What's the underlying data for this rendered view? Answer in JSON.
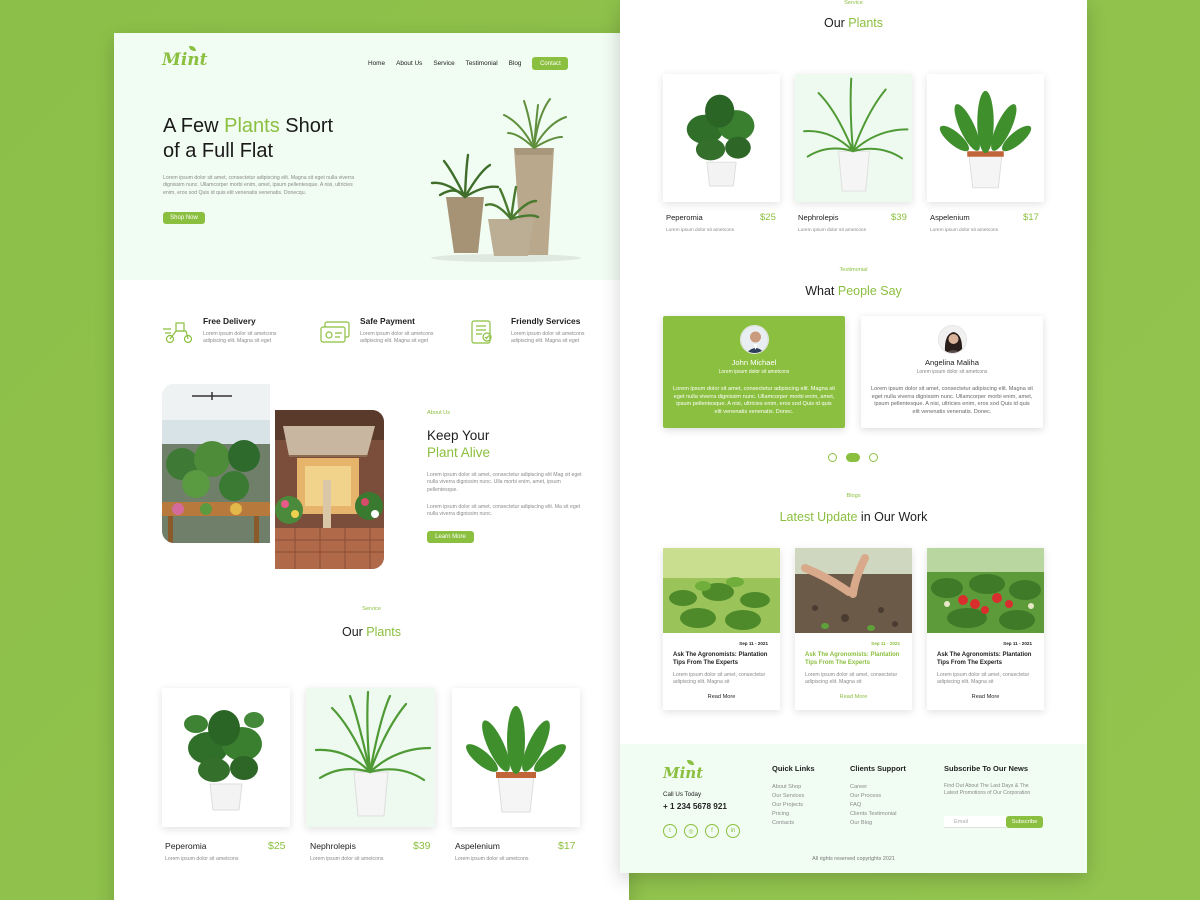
{
  "colors": {
    "accent": "#8bbf3f",
    "hero_bg": "#f1fcf3",
    "background": "#8fc04a"
  },
  "brand": {
    "logo_text": "Mint"
  },
  "nav": {
    "items": [
      "Home",
      "About Us",
      "Service",
      "Testimonial",
      "Blog"
    ],
    "contact": "Contact"
  },
  "hero": {
    "title_pre": "A Few ",
    "title_accent": "Plants",
    "title_post": " Short",
    "title_line2": "of a Full Flat",
    "desc": "Lorem ipsum dolor sit amet, consectetur adipiscing elit. Magna sit eget nulla viverra dignissim nunc. Ullamcorper morbi enim, amet, ipsum pellentesque. A nisi, ultricies enim, eros sod Quis id quis elit venenatis venenatis. Donecqu.",
    "cta": "Shop Now"
  },
  "features": [
    {
      "icon": "delivery-scooter-icon",
      "title": "Free Delivery",
      "desc": "Lorem ipsum dolor sit ametcons adipiscing elit. Magna sit eget"
    },
    {
      "icon": "payment-card-icon",
      "title": "Safe Payment",
      "desc": "Lorem ipsum dolor sit ametcons adipiscing elit. Magna sit eget"
    },
    {
      "icon": "support-document-icon",
      "title": "Friendly Services",
      "desc": "Lorem ipsum dolor sit ametcons adipiscing elit. Magna sit eget"
    }
  ],
  "about": {
    "tag": "About Us",
    "title_line1": "Keep Your",
    "title_line2": "Plant Alive",
    "para1": "Lorem ipsum dolor sit amet, consectetur adipiscing elit Mag sit eget nulla viverra dignissim nunc. Ulla morbi enim, amet, ipsum pellentesque.",
    "para2": "Lorem ipsum dolor sit amet, consectetur adipiscing elit. Ma sit eget nulla viverra dignissim nunc.",
    "cta": "Learn More"
  },
  "plants_section": {
    "tag": "Service",
    "title_pre": "Our ",
    "title_accent": "Plants"
  },
  "plants": [
    {
      "name": "Peperomia",
      "price": "$25",
      "desc": "Lorem ipsum dolor sit ametcons"
    },
    {
      "name": "Nephrolepis",
      "price": "$39",
      "desc": "Lorem ipsum dolor sit ametcons"
    },
    {
      "name": "Aspelenium",
      "price": "$17",
      "desc": "Lorem ipsum dolor sit ametcons"
    }
  ],
  "testimonial_section": {
    "tag": "Testimonial",
    "title_pre": "What ",
    "title_accent": "People Say"
  },
  "testimonials": [
    {
      "name": "John Michael",
      "sub": "Lorem ipsum dolor sit ametcons",
      "text": "Lorem ipsum dolor sit amet, consectetur adipiscing elit. Magna sit eget nulla viverra dignissim nunc. Ullamcorper morbi enim, amet, ipsum pellentesque. A nisi, ultricies enim, eros sod Quis id quis elit venenatis venenatis. Donec."
    },
    {
      "name": "Angelina Maliha",
      "sub": "Lorem ipsum dolor sit ametcons",
      "text": "Lorem ipsum dolor sit amet, consectetur adipiscing elit. Magna sit eget nulla viverra dignissim nunc. Ullamcorper morbi enim, amet, ipsum pellentesque. A nisi, ultricies enim, eros sod Quis id quis elit venenatis venenatis. Donec."
    }
  ],
  "slider": {
    "active_index": 1,
    "count": 3
  },
  "blog_section": {
    "tag": "Blogs",
    "title_accent": "Latest Update",
    "title_post": " in Our Work"
  },
  "blogs": [
    {
      "date": "Sep 11 - 2021",
      "title": "Ask The Agronomists: Plantation Tips From The Experts",
      "text": "Lorem ipsum dolor sit amet, consectetur adipiscing elit. Magna sit",
      "read": "Read More"
    },
    {
      "date": "Sep 11 - 2021",
      "title": "Ask The Agronomists: Plantation Tips From The Experts",
      "text": "Lorem ipsum dolor sit amet, consectetur adipiscing elit. Magna sit",
      "read": "Read More"
    },
    {
      "date": "Sep 11 - 2021",
      "title": "Ask The Agronomists: Plantation Tips From The Experts",
      "text": "Lorem ipsum dolor sit amet, consectetur adipiscing elit. Magna sit",
      "read": "Read More"
    }
  ],
  "footer": {
    "call_label": "Call Us Today",
    "phone": "+ 1 234 5678 921",
    "quick_title": "Quick Links",
    "quick_links": [
      "About Shop",
      "Our Services",
      "Our Projects",
      "Pricing",
      "Contacts"
    ],
    "support_title": "Clients Support",
    "support_links": [
      "Career",
      "Our Process",
      "FAQ",
      "Clients Testimonial",
      "Our Blog"
    ],
    "news_title": "Subscribe To Our News",
    "news_text": "Find Out About The Last Days & The Latest Promotions of Our Corporation",
    "email_placeholder": "Email",
    "subscribe": "Subscribe",
    "copyright": "All rights reserved copyrights 2021",
    "socials": [
      "twitter-icon",
      "instagram-icon",
      "facebook-icon",
      "linkedin-icon"
    ]
  }
}
